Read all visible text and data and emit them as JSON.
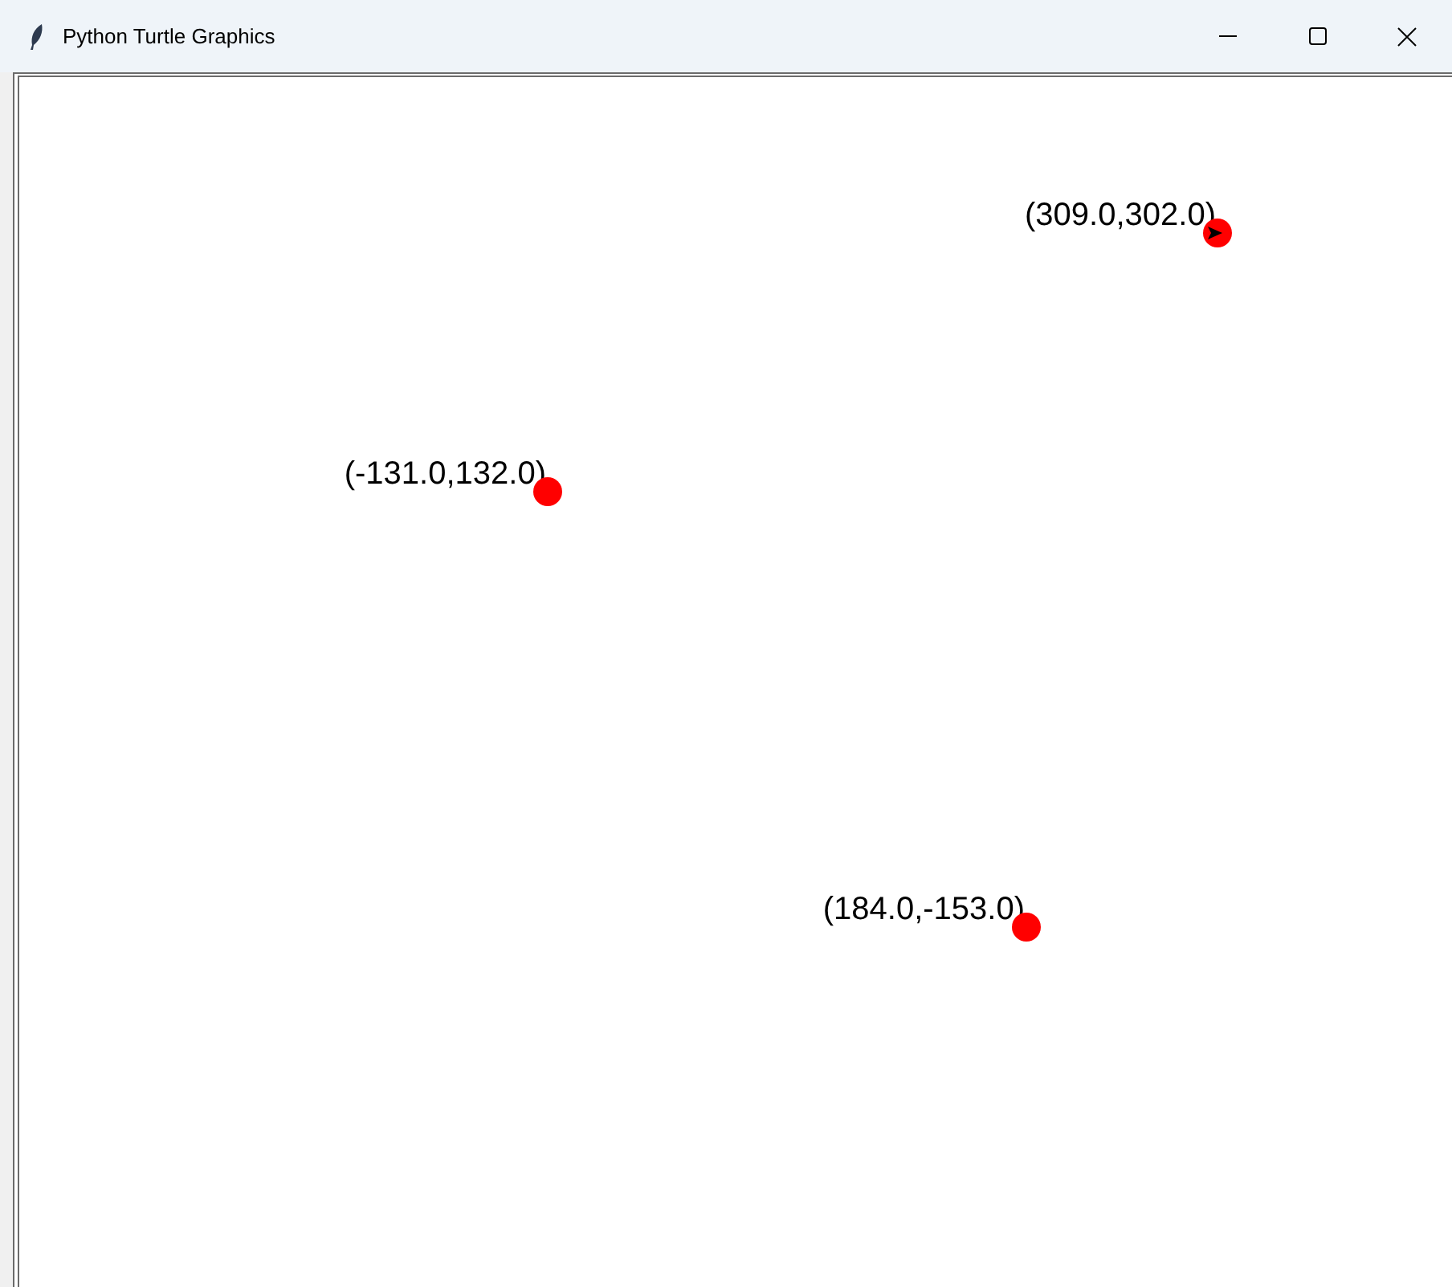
{
  "window": {
    "title": "Python Turtle Graphics"
  },
  "canvas": {
    "points": [
      {
        "label": "(309.0,302.0)",
        "turtle": true
      },
      {
        "label": "(-131.0,132.0)",
        "turtle": false
      },
      {
        "label": "(184.0,-153.0)",
        "turtle": false
      }
    ]
  }
}
